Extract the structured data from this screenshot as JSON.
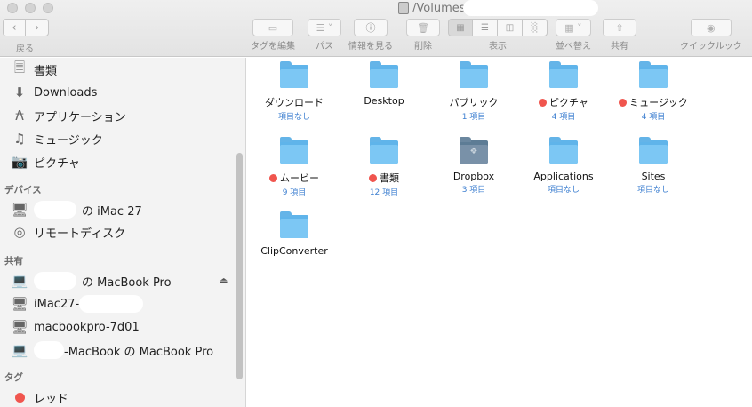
{
  "window": {
    "title": "/Volumes"
  },
  "toolbar": {
    "back_label": "戻る",
    "tag_edit_label": "タグを編集",
    "path_label": "パス",
    "info_label": "情報を見る",
    "delete_label": "削除",
    "view_label": "表示",
    "sort_label": "並べ替え",
    "share_label": "共有",
    "quicklook_label": "クイックルック"
  },
  "sidebar": {
    "favorites": [
      {
        "label": "書類",
        "icon": "documents-icon"
      },
      {
        "label": "Downloads",
        "icon": "downloads-icon"
      },
      {
        "label": "アプリケーション",
        "icon": "applications-icon"
      },
      {
        "label": "ミュージック",
        "icon": "music-icon"
      },
      {
        "label": "ピクチャ",
        "icon": "camera-icon"
      }
    ],
    "devices_header": "デバイス",
    "devices": [
      {
        "label": "の iMac 27",
        "icon": "imac-icon"
      },
      {
        "label": "リモートディスク",
        "icon": "remote-disc-icon"
      }
    ],
    "shared_header": "共有",
    "shared": [
      {
        "label": "の MacBook Pro",
        "icon": "laptop-icon"
      },
      {
        "label": "iMac27-",
        "icon": "imac-icon"
      },
      {
        "label": "macbookpro-7d01",
        "icon": "imac-icon"
      },
      {
        "label": "-MacBook の MacBook Pro",
        "icon": "laptop-icon"
      }
    ],
    "tags_header": "タグ",
    "tags": [
      {
        "label": "レッド",
        "color": "#f0554e"
      }
    ]
  },
  "content": {
    "items": [
      {
        "name": "ダウンロード",
        "count": "項目なし",
        "tag": false,
        "kind": "folder"
      },
      {
        "name": "Desktop",
        "count": "",
        "tag": false,
        "kind": "folder"
      },
      {
        "name": "パブリック",
        "count": "1 項目",
        "tag": false,
        "kind": "folder"
      },
      {
        "name": "ピクチャ",
        "count": "4 項目",
        "tag": true,
        "kind": "folder"
      },
      {
        "name": "ミュージック",
        "count": "4 項目",
        "tag": true,
        "kind": "folder"
      },
      {
        "name": "ムービー",
        "count": "9 項目",
        "tag": true,
        "kind": "folder"
      },
      {
        "name": "書類",
        "count": "12 項目",
        "tag": true,
        "kind": "folder"
      },
      {
        "name": "Dropbox",
        "count": "3 項目",
        "tag": false,
        "kind": "dropbox"
      },
      {
        "name": "Applications",
        "count": "項目なし",
        "tag": false,
        "kind": "folder"
      },
      {
        "name": "Sites",
        "count": "項目なし",
        "tag": false,
        "kind": "folder"
      },
      {
        "name": "ClipConverter",
        "count": "",
        "tag": false,
        "kind": "folder"
      }
    ]
  }
}
